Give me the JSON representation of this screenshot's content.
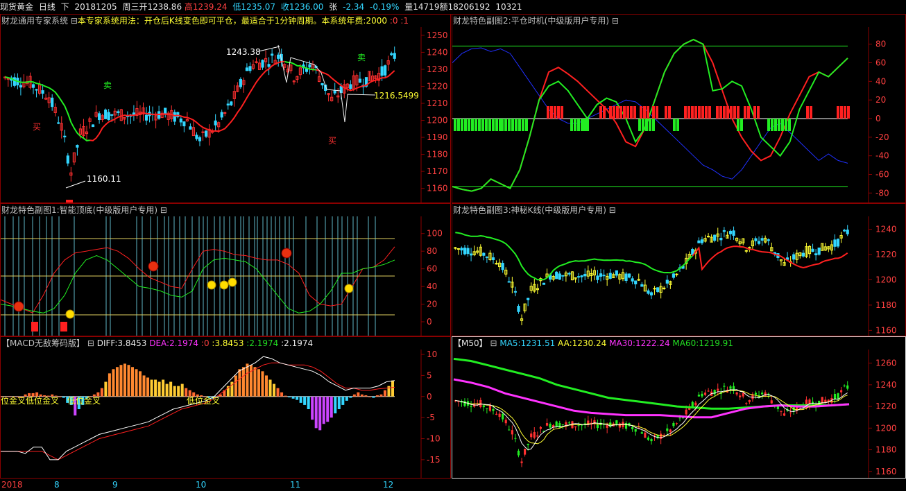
{
  "header": {
    "symbol": "现货黄金",
    "period": "日线",
    "direction": "下",
    "date": "20181205",
    "weekday": "周三",
    "open": "开1238.86",
    "high": "高1239.24",
    "low": "低1235.07",
    "close": "收1236.00",
    "change_label": "张",
    "change": "-2.34",
    "change_pct": "-0.19%",
    "volume": "量14719",
    "amount": "额18206192",
    "extra": "10321"
  },
  "panel_main": {
    "title_a": "财龙通用专家系统",
    "collapse": "⊟",
    "title_b": "本专家系统用法：开仓后K线变色即可平仓，最适合于1分钟周期。本系统年费:2000",
    "title_c": ":0 :1",
    "y_ticks": [
      "1250",
      "1240",
      "1230",
      "1220",
      "1210",
      "1200",
      "1190",
      "1180",
      "1170",
      "1160"
    ],
    "annotations": {
      "high": "1243.38",
      "low": "1160.11",
      "last": "1216.5499"
    },
    "signals": {
      "buy1": "买",
      "sell1": "卖",
      "buy2": "买",
      "sell2": "卖"
    }
  },
  "panel_sub1": {
    "title": "财龙特色副图1:智能顶底(中级版用户专用)",
    "collapse": "⊟",
    "y_ticks": [
      "100",
      "80",
      "60",
      "40",
      "20",
      "0"
    ]
  },
  "panel_sub2": {
    "title": "财龙特色副图2:平仓时机(中级版用户专用)",
    "collapse": "⊟",
    "y_ticks": [
      "80",
      "60",
      "40",
      "20",
      "0",
      "-20",
      "-40",
      "-60",
      "-80"
    ]
  },
  "panel_sub3": {
    "title": "财龙特色副图3:神秘K线(中级版用户专用)",
    "collapse": "⊟",
    "y_ticks": [
      "1240",
      "1220",
      "1200",
      "1180",
      "1160"
    ]
  },
  "panel_macd": {
    "title": "【MACD无敌筹码版】",
    "collapse": "⊟",
    "diff": "DIFF:3.8453",
    "dea": "DEA:2.1974",
    "v0": ":0",
    "v1": ":3.8453",
    "v2": ":2.1974",
    "v3": ":2.1974",
    "y_ticks": [
      "10",
      "5",
      "0",
      "-5",
      "-10",
      "-15"
    ],
    "labels": [
      "位金叉",
      "低位金叉",
      "低位金叉",
      "低位金叉"
    ]
  },
  "panel_m50": {
    "title": "【M50】",
    "collapse": "⊟",
    "ma5": "MA5:1231.51",
    "aa": "AA:1230.24",
    "ma30": "MA30:1222.24",
    "ma60": "MA60:1219.91",
    "y_ticks": [
      "1260",
      "1240",
      "1220",
      "1200",
      "1180",
      "1160"
    ]
  },
  "x_axis": [
    "2018",
    "8",
    "9",
    "10",
    "11",
    "12"
  ],
  "colors": {
    "up": "#ff3030",
    "down": "#33d6ff",
    "frame": "#8b0000",
    "ma_green": "#22ee22",
    "ma_magenta": "#ff33ff",
    "axis_text": "#ff4040"
  }
}
